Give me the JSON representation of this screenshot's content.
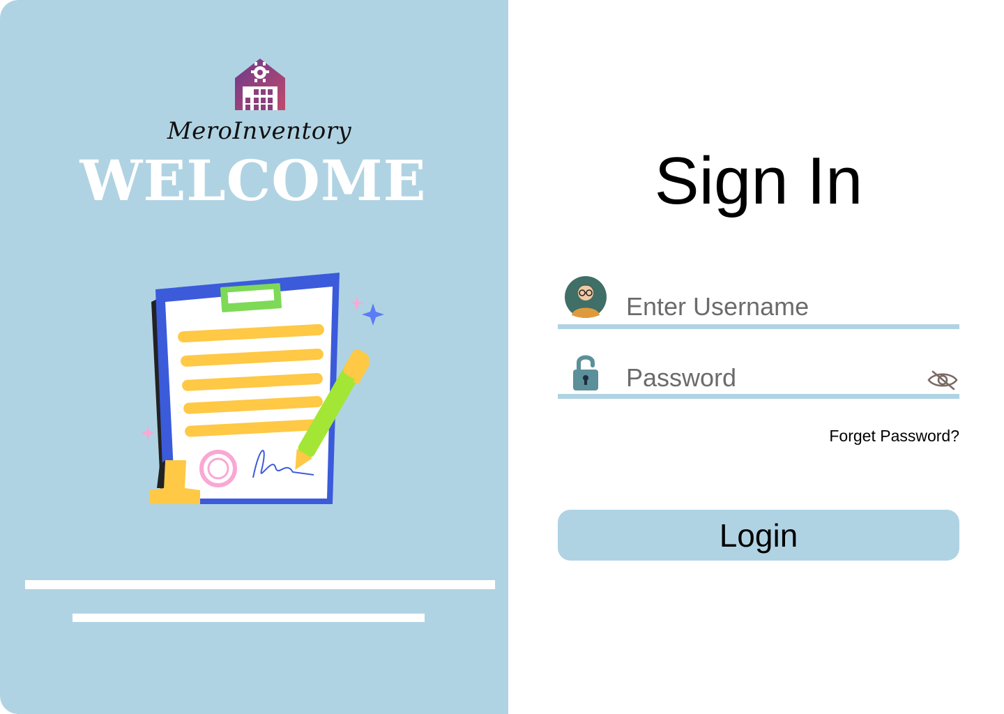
{
  "brand": {
    "name": "MeroInventory",
    "logo_icon": "warehouse-gear-icon"
  },
  "welcome": {
    "heading": "WELCOME",
    "illustration": "clipboard-document-signature-illustration"
  },
  "signin": {
    "title": "Sign In",
    "username": {
      "placeholder": "Enter Username",
      "value": "",
      "icon": "user-avatar-icon"
    },
    "password": {
      "placeholder": "Password",
      "value": "",
      "icon": "lock-open-icon",
      "toggle_icon": "eye-off-icon"
    },
    "forgot_label": "Forget Password?",
    "login_label": "Login"
  },
  "colors": {
    "panel": "#b0d3e3",
    "accent_logo": "#a0426b",
    "text": "#000000"
  }
}
